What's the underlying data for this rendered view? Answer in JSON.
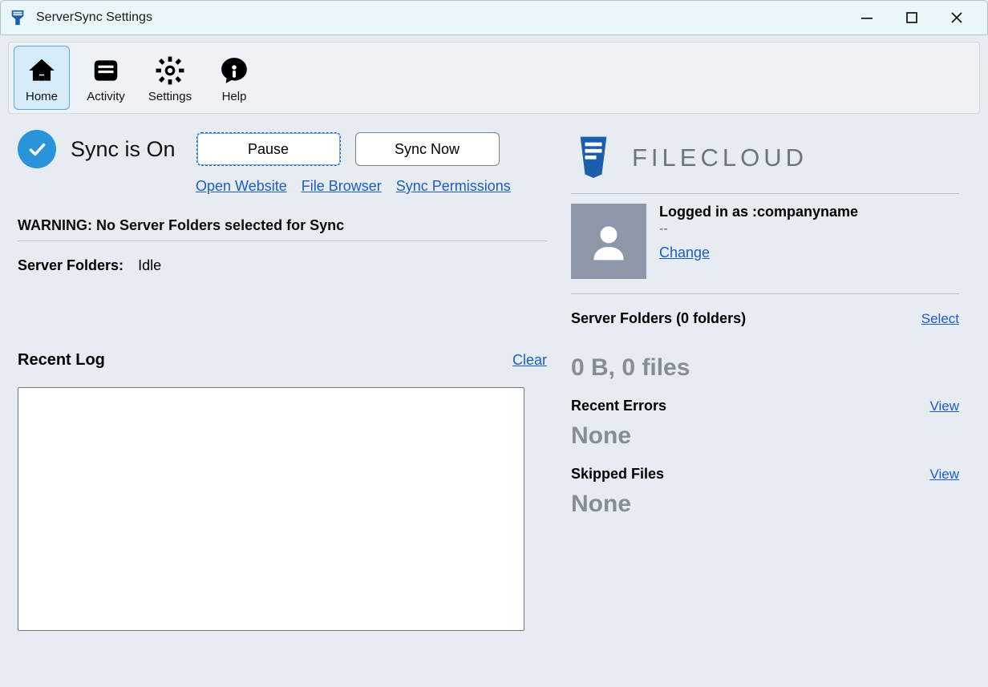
{
  "window_title": "ServerSync Settings",
  "toolbar": {
    "home": "Home",
    "activity": "Activity",
    "settings": "Settings",
    "help": "Help"
  },
  "sync": {
    "status_label": "Sync is On",
    "pause_btn": "Pause",
    "sync_now_btn": "Sync Now",
    "open_website": "Open Website",
    "file_browser": "File Browser",
    "sync_permissions": "Sync Permissions"
  },
  "warning": "WARNING: No Server Folders selected for Sync",
  "server_folders": {
    "label": "Server Folders:",
    "status": "Idle"
  },
  "log": {
    "title": "Recent Log",
    "clear": "Clear"
  },
  "brand": {
    "name": "FILECLOUD"
  },
  "account": {
    "logged_in_as_label": "Logged in as :",
    "username": "companyname",
    "subline": "--",
    "change": "Change"
  },
  "right": {
    "server_folders_label": "Server Folders (0 folders)",
    "select": "Select",
    "summary": "0 B, 0 files",
    "recent_errors_label": "Recent Errors",
    "view": "View",
    "errors_value": "None",
    "skipped_label": "Skipped Files",
    "skipped_value": "None"
  }
}
